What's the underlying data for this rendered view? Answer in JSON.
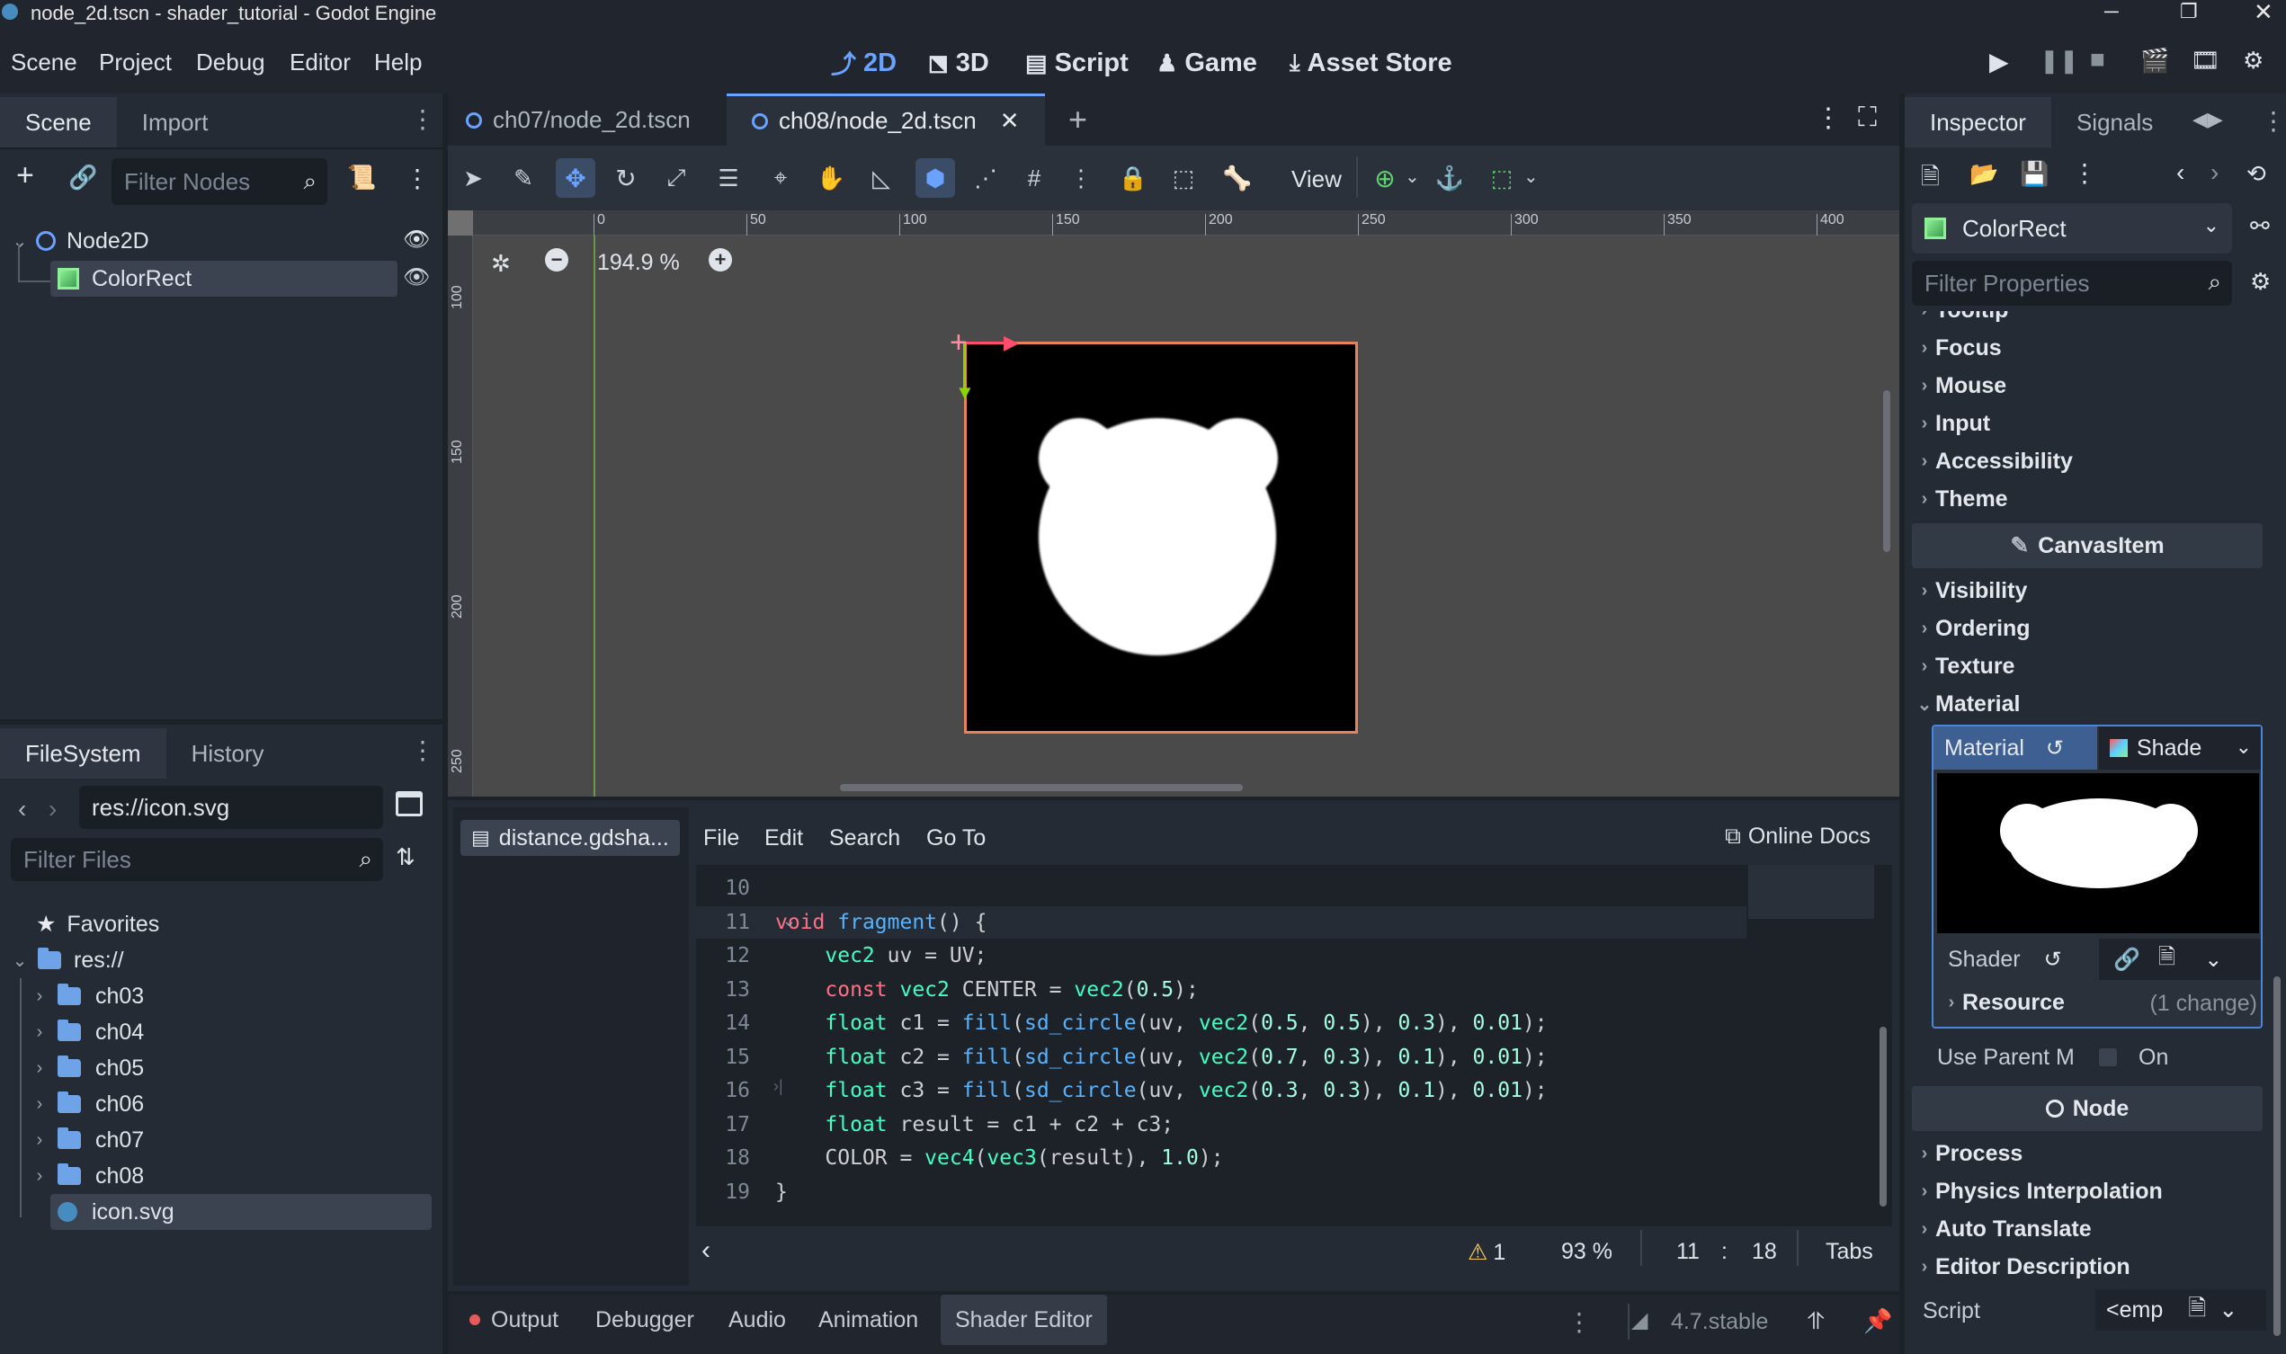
{
  "window": {
    "title": "node_2d.tscn - shader_tutorial - Godot Engine"
  },
  "menu": [
    "Scene",
    "Project",
    "Debug",
    "Editor",
    "Help"
  ],
  "workspaces": [
    {
      "label": "2D",
      "icon": "2d-icon",
      "active": true
    },
    {
      "label": "3D",
      "icon": "3d-icon"
    },
    {
      "label": "Script",
      "icon": "script-icon"
    },
    {
      "label": "Game",
      "icon": "game-icon"
    },
    {
      "label": "Asset Store",
      "icon": "asset-store-icon"
    }
  ],
  "scene_dock": {
    "tabs": [
      "Scene",
      "Import"
    ],
    "filter_placeholder": "Filter Nodes",
    "nodes": [
      {
        "name": "Node2D",
        "icon": "node2d-icon"
      },
      {
        "name": "ColorRect",
        "icon": "colorrect-icon",
        "selected": true
      }
    ]
  },
  "filesystem_dock": {
    "tabs": [
      "FileSystem",
      "History"
    ],
    "path": "res://icon.svg",
    "filter_placeholder": "Filter Files",
    "favorites_label": "Favorites",
    "root_label": "res://",
    "folders": [
      "ch03",
      "ch04",
      "ch05",
      "ch06",
      "ch07",
      "ch08"
    ],
    "selected_file": "icon.svg"
  },
  "scene_tabs": [
    "ch07/node_2d.tscn",
    "ch08/node_2d.tscn"
  ],
  "toolbar": {
    "view_label": "View"
  },
  "viewport": {
    "zoom": "194.9 %",
    "ruler_h": [
      "0",
      "50",
      "100",
      "150",
      "200",
      "250",
      "300",
      "350",
      "400"
    ],
    "ruler_v": [
      "100",
      "150",
      "200",
      "250"
    ]
  },
  "shader_editor": {
    "file_tab": "distance.gdsha...",
    "menu": [
      "File",
      "Edit",
      "Search",
      "Go To"
    ],
    "online_docs": "Online Docs",
    "lines": [
      {
        "n": "10",
        "segs": []
      },
      {
        "n": "11",
        "segs": [
          [
            "kw",
            "void "
          ],
          [
            "fn",
            "fragment"
          ],
          [
            "pl",
            "() {"
          ]
        ]
      },
      {
        "n": "12",
        "segs": [
          [
            "pl",
            "    "
          ],
          [
            "ty",
            "vec2"
          ],
          [
            "pl",
            " uv = UV;"
          ]
        ]
      },
      {
        "n": "13",
        "segs": [
          [
            "pl",
            "    "
          ],
          [
            "kw",
            "const "
          ],
          [
            "ty",
            "vec2"
          ],
          [
            "pl",
            " CENTER = "
          ],
          [
            "ty",
            "vec2"
          ],
          [
            "pl",
            "("
          ],
          [
            "num",
            "0.5"
          ],
          [
            "pl",
            ");"
          ]
        ]
      },
      {
        "n": "14",
        "segs": [
          [
            "pl",
            "    "
          ],
          [
            "ty",
            "float"
          ],
          [
            "pl",
            " c1 = "
          ],
          [
            "fn",
            "fill"
          ],
          [
            "pl",
            "("
          ],
          [
            "fn",
            "sd_circle"
          ],
          [
            "pl",
            "(uv, "
          ],
          [
            "ty",
            "vec2"
          ],
          [
            "pl",
            "("
          ],
          [
            "num",
            "0.5"
          ],
          [
            "pl",
            ", "
          ],
          [
            "num",
            "0.5"
          ],
          [
            "pl",
            "), "
          ],
          [
            "num",
            "0.3"
          ],
          [
            "pl",
            "), "
          ],
          [
            "num",
            "0.01"
          ],
          [
            "pl",
            ");"
          ]
        ]
      },
      {
        "n": "15",
        "segs": [
          [
            "pl",
            "    "
          ],
          [
            "ty",
            "float"
          ],
          [
            "pl",
            " c2 = "
          ],
          [
            "fn",
            "fill"
          ],
          [
            "pl",
            "("
          ],
          [
            "fn",
            "sd_circle"
          ],
          [
            "pl",
            "(uv, "
          ],
          [
            "ty",
            "vec2"
          ],
          [
            "pl",
            "("
          ],
          [
            "num",
            "0.7"
          ],
          [
            "pl",
            ", "
          ],
          [
            "num",
            "0.3"
          ],
          [
            "pl",
            "), "
          ],
          [
            "num",
            "0.1"
          ],
          [
            "pl",
            "), "
          ],
          [
            "num",
            "0.01"
          ],
          [
            "pl",
            ");"
          ]
        ]
      },
      {
        "n": "16",
        "segs": [
          [
            "pl",
            "    "
          ],
          [
            "ty",
            "float"
          ],
          [
            "pl",
            " c3 = "
          ],
          [
            "fn",
            "fill"
          ],
          [
            "pl",
            "("
          ],
          [
            "fn",
            "sd_circle"
          ],
          [
            "pl",
            "(uv, "
          ],
          [
            "ty",
            "vec2"
          ],
          [
            "pl",
            "("
          ],
          [
            "num",
            "0.3"
          ],
          [
            "pl",
            ", "
          ],
          [
            "num",
            "0.3"
          ],
          [
            "pl",
            "), "
          ],
          [
            "num",
            "0.1"
          ],
          [
            "pl",
            "), "
          ],
          [
            "num",
            "0.01"
          ],
          [
            "pl",
            ");"
          ]
        ]
      },
      {
        "n": "17",
        "segs": [
          [
            "pl",
            "    "
          ],
          [
            "ty",
            "float"
          ],
          [
            "pl",
            " result = c1 + c2 + c3;"
          ]
        ]
      },
      {
        "n": "18",
        "segs": [
          [
            "pl",
            "    COLOR = "
          ],
          [
            "ty",
            "vec4"
          ],
          [
            "pl",
            "("
          ],
          [
            "ty",
            "vec3"
          ],
          [
            "pl",
            "(result), "
          ],
          [
            "num",
            "1.0"
          ],
          [
            "pl",
            ");"
          ]
        ]
      },
      {
        "n": "19",
        "segs": [
          [
            "pl",
            "}"
          ]
        ]
      }
    ],
    "status": {
      "warnings": "1",
      "zoom": "93 %",
      "line": "11",
      "col": "18",
      "indent": "Tabs"
    }
  },
  "bottom_panel": {
    "tabs": [
      "Output",
      "Debugger",
      "Audio",
      "Animation",
      "Shader Editor"
    ],
    "version": "4.7.stable"
  },
  "inspector": {
    "tabs": [
      "Inspector",
      "Signals"
    ],
    "object": "ColorRect",
    "filter_placeholder": "Filter Properties",
    "top_cut": "Tooltip",
    "groups1": [
      "Focus",
      "Mouse",
      "Input",
      "Accessibility",
      "Theme"
    ],
    "section_canvas": "CanvasItem",
    "groups2": [
      "Visibility",
      "Ordering",
      "Texture"
    ],
    "material_group": "Material",
    "material_label": "Material",
    "material_value": "Shade",
    "shader_label": "Shader",
    "resource_label": "Resource",
    "resource_changes": "(1 change)",
    "use_parent_label": "Use Parent M",
    "use_parent_value": "On",
    "section_node": "Node",
    "groups3": [
      "Process",
      "Physics Interpolation",
      "Auto Translate",
      "Editor Description"
    ],
    "script_label": "Script",
    "script_value": "<emp"
  },
  "colors": {
    "accent": "#6aa2ff",
    "selection_border": "#e8825a",
    "bg": "#1d2229"
  }
}
